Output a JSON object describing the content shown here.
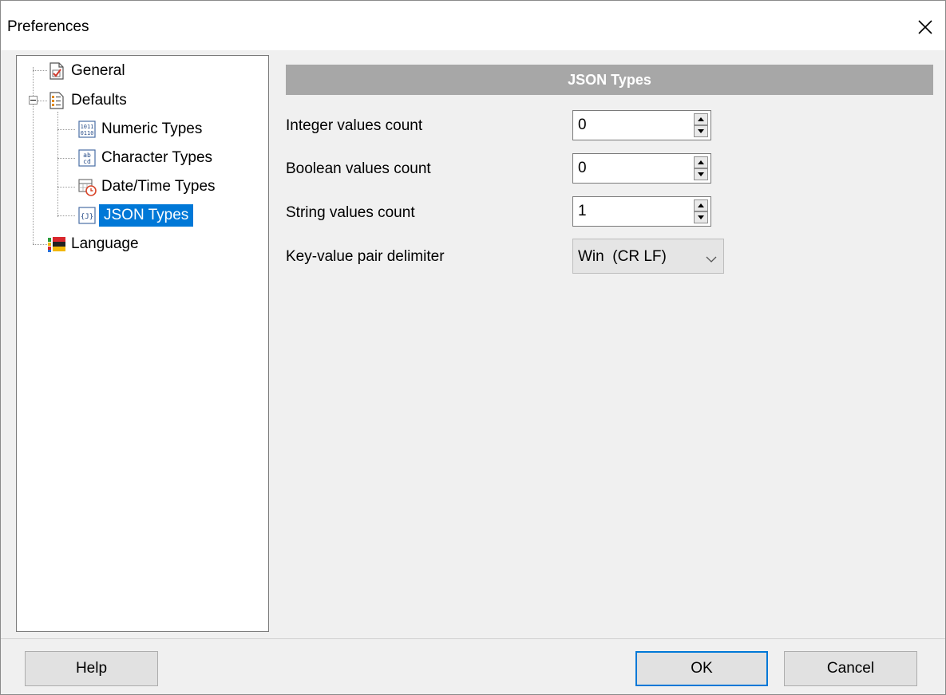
{
  "window": {
    "title": "Preferences"
  },
  "tree": {
    "items": [
      {
        "label": "General",
        "icon": "general-settings-icon"
      },
      {
        "label": "Defaults",
        "icon": "defaults-list-icon"
      },
      {
        "label": "Numeric Types",
        "icon": "numeric-types-icon"
      },
      {
        "label": "Character Types",
        "icon": "character-types-icon"
      },
      {
        "label": "Date/Time Types",
        "icon": "datetime-types-icon"
      },
      {
        "label": "JSON Types",
        "icon": "json-types-icon",
        "selected": true
      },
      {
        "label": "Language",
        "icon": "language-flag-icon"
      }
    ]
  },
  "panel": {
    "header": "JSON Types",
    "fields": [
      {
        "label": "Integer values count",
        "value": "0"
      },
      {
        "label": "Boolean values count",
        "value": "0"
      },
      {
        "label": "String values count",
        "value": "1"
      }
    ],
    "delimiter": {
      "label": "Key-value pair delimiter",
      "value": "Win  (CR LF)"
    }
  },
  "buttons": {
    "help": "Help",
    "ok": "OK",
    "cancel": "Cancel"
  },
  "colors": {
    "selection": "#0078d7",
    "header_bar": "#a7a7a7"
  }
}
